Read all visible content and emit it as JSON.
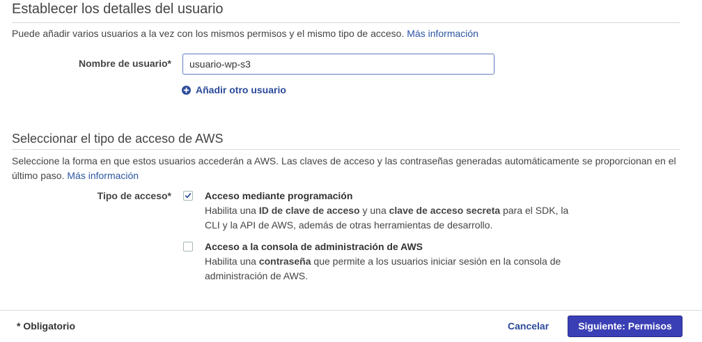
{
  "section1": {
    "title": "Establecer los detalles del usuario",
    "description": "Puede añadir varios usuarios a la vez con los mismos permisos y el mismo tipo de acceso.",
    "more_info_link": "Más información",
    "username_label": "Nombre de usuario*",
    "username_value": "usuario-wp-s3",
    "add_user_link": "Añadir otro usuario"
  },
  "section2": {
    "title": "Seleccionar el tipo de acceso de AWS",
    "description_line1": "Seleccione la forma en que estos usuarios accederán a AWS. Las claves de acceso y las contraseñas generadas automáticamente se proporcionan en el",
    "description_line2": "último paso.",
    "more_info_link": "Más información",
    "access_type_label": "Tipo de acceso*",
    "options": [
      {
        "checked": true,
        "title": "Acceso mediante programación",
        "desc_parts": [
          "Habilita una ",
          "ID de clave de acceso",
          " y una ",
          "clave de acceso secreta",
          " para el SDK, la",
          "CLI y la API de AWS, además de otras herramientas de desarrollo."
        ]
      },
      {
        "checked": false,
        "title": "Acceso a la consola de administración de AWS",
        "desc_parts": [
          "Habilita una ",
          "contraseña",
          " que permite a los usuarios iniciar sesión en la consola de",
          "administración de AWS."
        ]
      }
    ]
  },
  "footer": {
    "required_note": "* Obligatorio",
    "cancel_label": "Cancelar",
    "next_label": "Siguiente: Permisos"
  },
  "colors": {
    "link": "#2b55a1",
    "primary_button": "#3a3fb5",
    "input_focus_border": "#6f87c2"
  }
}
